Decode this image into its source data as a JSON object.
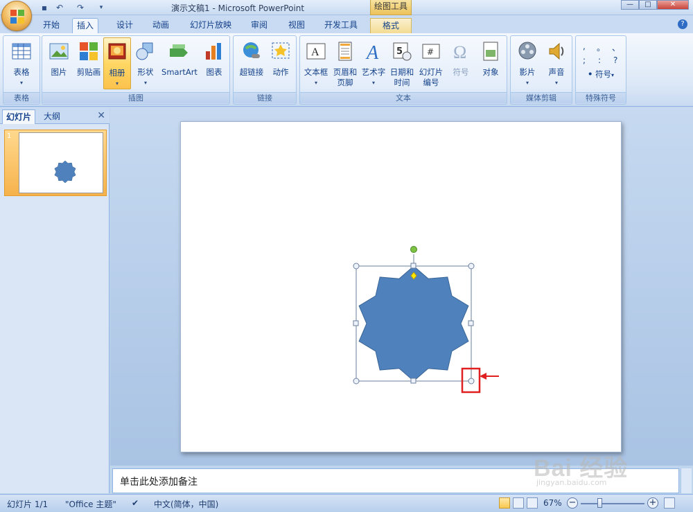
{
  "titlebar": {
    "title": "演示文稿1 - Microsoft PowerPoint",
    "contextual_tab": "绘图工具"
  },
  "tabs": [
    {
      "label": "开始"
    },
    {
      "label": "插入"
    },
    {
      "label": "设计"
    },
    {
      "label": "动画"
    },
    {
      "label": "幻灯片放映"
    },
    {
      "label": "审阅"
    },
    {
      "label": "视图"
    },
    {
      "label": "开发工具"
    },
    {
      "label": "格式"
    }
  ],
  "active_tab": "插入",
  "ribbon": {
    "groups": [
      {
        "label": "表格",
        "buttons": [
          {
            "label": "表格",
            "icon": "table-icon"
          }
        ]
      },
      {
        "label": "插图",
        "buttons": [
          {
            "label": "图片",
            "icon": "picture-icon"
          },
          {
            "label": "剪贴画",
            "icon": "clipart-icon"
          },
          {
            "label": "相册",
            "icon": "photo-album-icon"
          },
          {
            "label": "形状",
            "icon": "shapes-icon"
          },
          {
            "label": "SmartArt",
            "icon": "smartart-icon"
          },
          {
            "label": "图表",
            "icon": "chart-icon"
          }
        ]
      },
      {
        "label": "链接",
        "buttons": [
          {
            "label": "超链接",
            "icon": "hyperlink-icon"
          },
          {
            "label": "动作",
            "icon": "action-icon"
          }
        ]
      },
      {
        "label": "文本",
        "buttons": [
          {
            "label": "文本框",
            "icon": "textbox-icon"
          },
          {
            "label": "页眉和页脚",
            "line1": "页眉和",
            "line2": "页脚",
            "icon": "header-footer-icon"
          },
          {
            "label": "艺术字",
            "icon": "wordart-icon"
          },
          {
            "label": "日期和时间",
            "line1": "日期和",
            "line2": "时间",
            "icon": "datetime-icon"
          },
          {
            "label": "幻灯片编号",
            "line1": "幻灯片",
            "line2": "编号",
            "icon": "slide-number-icon"
          },
          {
            "label": "符号",
            "icon": "symbol-icon"
          },
          {
            "label": "对象",
            "icon": "object-icon"
          }
        ]
      },
      {
        "label": "媒体剪辑",
        "buttons": [
          {
            "label": "影片",
            "icon": "movie-icon"
          },
          {
            "label": "声音",
            "icon": "sound-icon"
          }
        ]
      },
      {
        "label": "特殊符号",
        "buttons": [
          {
            "label": "符号",
            "icon": "special-symbol-icon"
          }
        ]
      }
    ],
    "special_chars": [
      ",",
      "。",
      "、",
      ";",
      ":",
      "?"
    ]
  },
  "left_panel": {
    "tabs": [
      "幻灯片",
      "大纲"
    ],
    "close_label": "✕",
    "slide_number": "1"
  },
  "notes": {
    "placeholder": "单击此处添加备注"
  },
  "status_bar": {
    "slide_info": "幻灯片 1/1",
    "theme": "\"Office 主题\"",
    "language": "中文(简体，中国)",
    "zoom": "67%"
  },
  "shape": {
    "type": "10-point star",
    "fill_color": "#4f81bd",
    "outline_color": "#3a6696",
    "handle_color": "#4472c4",
    "rotation_handle_color": "#7dc242",
    "adjust_handle_color": "#ffe600",
    "highlight_color": "#e02020"
  },
  "watermark": {
    "text": "Bai 经验",
    "url": "jingyan.baidu.com"
  },
  "colors": {
    "accent_blue": "#15428b",
    "ribbon_bg": "#dce8f7",
    "selected_button": "#ffd765"
  }
}
